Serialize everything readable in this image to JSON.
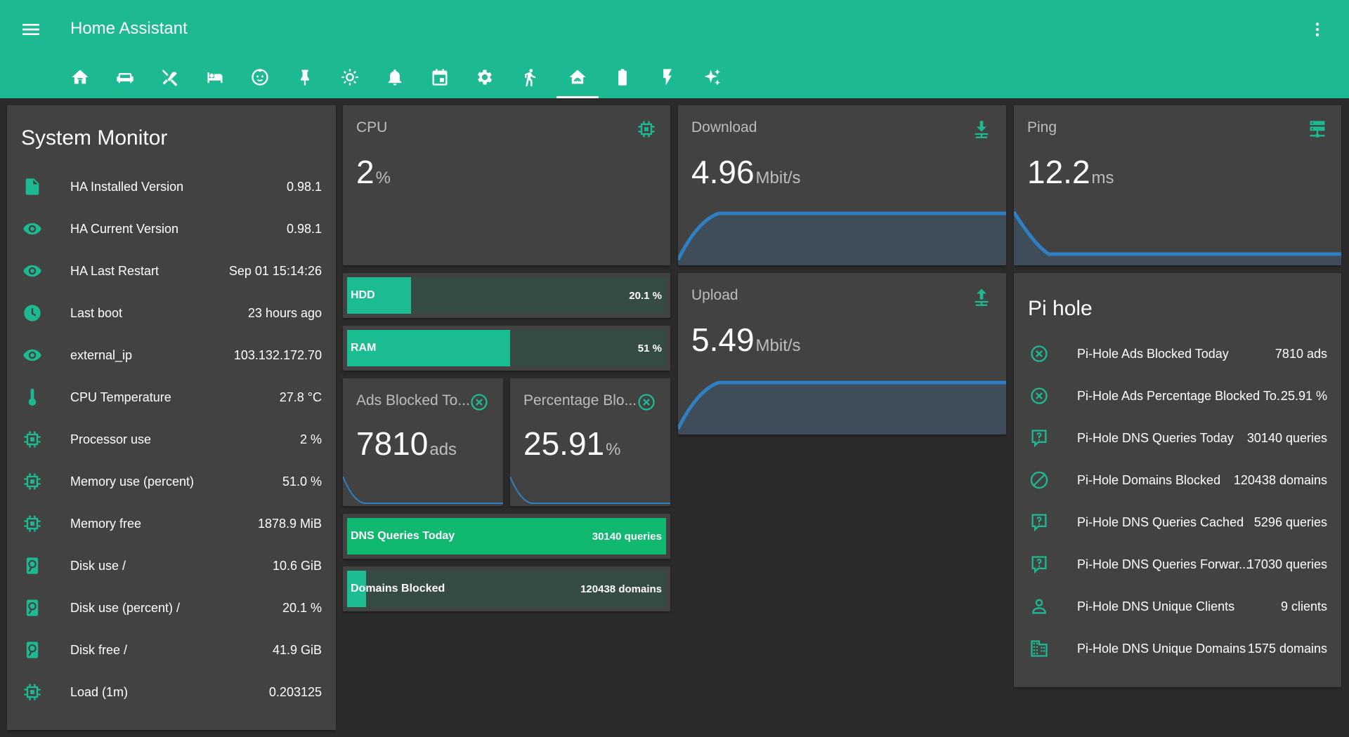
{
  "app": {
    "title": "Home Assistant"
  },
  "colors": {
    "accent": "#1db992",
    "icon": "#1db992",
    "graph_line": "#2f7fc2",
    "card": "#424242",
    "background": "#2b2b2b",
    "bar_fill": "#1bbc92",
    "bar_track": "#364b44"
  },
  "tabs": [
    {
      "icon": "home-icon"
    },
    {
      "icon": "sofa-icon"
    },
    {
      "icon": "utensils-icon"
    },
    {
      "icon": "bed-icon"
    },
    {
      "icon": "baby-face-icon"
    },
    {
      "icon": "pin-icon"
    },
    {
      "icon": "sun-icon"
    },
    {
      "icon": "bell-icon"
    },
    {
      "icon": "calendar-icon"
    },
    {
      "icon": "settings-icon"
    },
    {
      "icon": "walk-icon"
    },
    {
      "icon": "home-automation-icon",
      "active": true
    },
    {
      "icon": "battery-icon"
    },
    {
      "icon": "flash-icon"
    },
    {
      "icon": "sparkles-icon"
    }
  ],
  "system_monitor": {
    "title": "System Monitor",
    "rows": [
      {
        "icon": "file-icon",
        "label": "HA Installed Version",
        "value": "0.98.1"
      },
      {
        "icon": "eye-icon",
        "label": "HA Current Version",
        "value": "0.98.1"
      },
      {
        "icon": "eye-icon",
        "label": "HA Last Restart",
        "value": "Sep 01 15:14:26"
      },
      {
        "icon": "clock-icon",
        "label": "Last boot",
        "value": "23 hours ago"
      },
      {
        "icon": "eye-icon",
        "label": "external_ip",
        "value": "103.132.172.70"
      },
      {
        "icon": "thermometer-icon",
        "label": "CPU Temperature",
        "value": "27.8 °C"
      },
      {
        "icon": "chip-icon",
        "label": "Processor use",
        "value": "2 %"
      },
      {
        "icon": "chip-icon",
        "label": "Memory use (percent)",
        "value": "51.0 %"
      },
      {
        "icon": "chip-icon",
        "label": "Memory free",
        "value": "1878.9 MiB"
      },
      {
        "icon": "harddisk-icon",
        "label": "Disk use /",
        "value": "10.6 GiB"
      },
      {
        "icon": "harddisk-icon",
        "label": "Disk use (percent) /",
        "value": "20.1 %"
      },
      {
        "icon": "harddisk-icon",
        "label": "Disk free /",
        "value": "41.9 GiB"
      },
      {
        "icon": "chip-icon",
        "label": "Load (1m)",
        "value": "0.203125"
      }
    ]
  },
  "cpu": {
    "name": "CPU",
    "value": "2",
    "unit": "%",
    "icon": "chip-icon"
  },
  "download": {
    "name": "Download",
    "value": "4.96",
    "unit": "Mbit/s",
    "icon": "download-network-icon"
  },
  "ping": {
    "name": "Ping",
    "value": "12.2",
    "unit": "ms",
    "icon": "server-network-icon"
  },
  "upload": {
    "name": "Upload",
    "value": "5.49",
    "unit": "Mbit/s",
    "icon": "upload-network-icon"
  },
  "hdd_bar": {
    "label": "HDD",
    "value": "20.1 %",
    "percent": 20.1
  },
  "ram_bar": {
    "label": "RAM",
    "value": "51 %",
    "percent": 51
  },
  "ads_blocked": {
    "name": "Ads Blocked To...",
    "value": "7810",
    "unit": "ads",
    "icon": "close-circle-icon"
  },
  "percentage_blocked": {
    "name": "Percentage Blo...",
    "value": "25.91",
    "unit": "%",
    "icon": "close-circle-icon"
  },
  "dns_bar": {
    "label": "DNS Queries Today",
    "value": "30140 queries",
    "percent": 100
  },
  "domains_bar": {
    "label": "Domains Blocked",
    "value": "120438 domains",
    "percent": 6
  },
  "pihole": {
    "title": "Pi hole",
    "rows": [
      {
        "icon": "close-circle-icon",
        "label": "Pi-Hole Ads Blocked Today",
        "value": "7810 ads"
      },
      {
        "icon": "close-circle-icon",
        "label": "Pi-Hole Ads Percentage Blocked To...",
        "value": "25.91 %"
      },
      {
        "icon": "comment-question-icon",
        "label": "Pi-Hole DNS Queries Today",
        "value": "30140 queries"
      },
      {
        "icon": "block-icon",
        "label": "Pi-Hole Domains Blocked",
        "value": "120438 domains"
      },
      {
        "icon": "comment-question-icon",
        "label": "Pi-Hole DNS Queries Cached",
        "value": "5296 queries"
      },
      {
        "icon": "comment-question-icon",
        "label": "Pi-Hole DNS Queries Forwar...",
        "value": "17030 queries"
      },
      {
        "icon": "account-icon",
        "label": "Pi-Hole DNS Unique Clients",
        "value": "9 clients"
      },
      {
        "icon": "domain-icon",
        "label": "Pi-Hole DNS Unique Domains",
        "value": "1575 domains"
      }
    ]
  }
}
